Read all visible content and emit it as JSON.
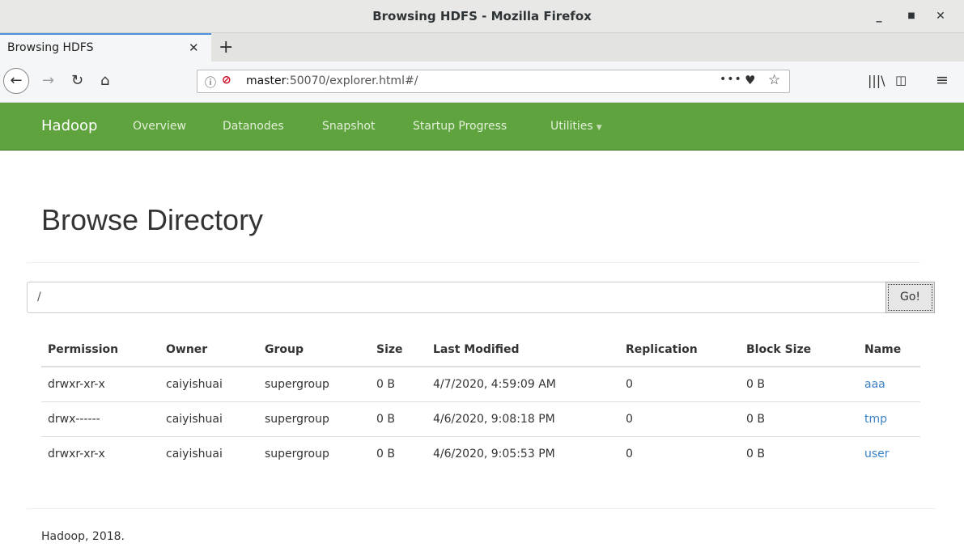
{
  "window": {
    "title": "Browsing HDFS - Mozilla Firefox"
  },
  "tabs": [
    {
      "label": "Browsing HDFS"
    }
  ],
  "browser": {
    "url_host": "master",
    "url_rest": ":50070/explorer.html#/",
    "icons": [
      "back-icon",
      "forward-icon",
      "reload-icon",
      "home-icon",
      "info-icon",
      "insecure-icon",
      "more-icon",
      "pocket-icon",
      "bookmark-star-icon",
      "library-icon",
      "sidebar-icon",
      "menu-icon"
    ]
  },
  "hadoop_nav": {
    "brand": "Hadoop",
    "links": [
      "Overview",
      "Datanodes",
      "Snapshot",
      "Startup Progress",
      "Utilities"
    ]
  },
  "main": {
    "title": "Browse Directory",
    "path_value": "/",
    "go_label": "Go!"
  },
  "table": {
    "headers": [
      "Permission",
      "Owner",
      "Group",
      "Size",
      "Last Modified",
      "Replication",
      "Block Size",
      "Name"
    ],
    "rows": [
      [
        "drwxr-xr-x",
        "caiyishuai",
        "supergroup",
        "0 B",
        "4/7/2020, 4:59:09 AM",
        "0",
        "0 B",
        "aaa"
      ],
      [
        "drwx------",
        "caiyishuai",
        "supergroup",
        "0 B",
        "4/6/2020, 9:08:18 PM",
        "0",
        "0 B",
        "tmp"
      ],
      [
        "drwxr-xr-x",
        "caiyishuai",
        "supergroup",
        "0 B",
        "4/6/2020, 9:05:53 PM",
        "0",
        "0 B",
        "user"
      ]
    ]
  },
  "footer": {
    "text": "Hadoop, 2018."
  },
  "colors": {
    "navbar": "#5fa33e",
    "link": "#3b83c6"
  }
}
